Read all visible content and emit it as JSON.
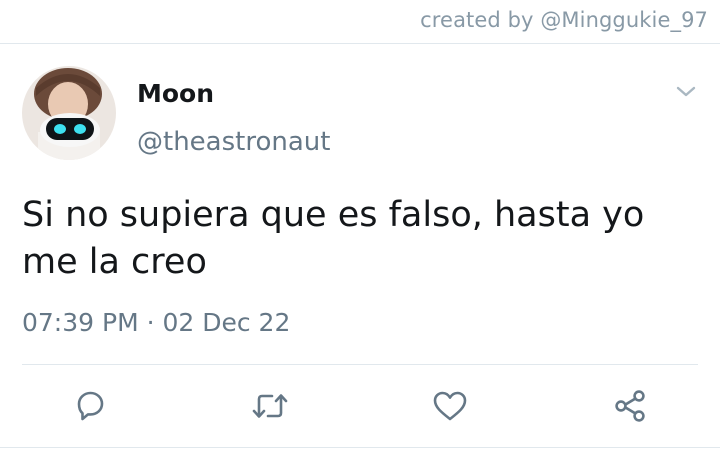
{
  "credit": {
    "text": "created by @Minggukie_97"
  },
  "tweet": {
    "author": {
      "display_name": "Moon",
      "handle": "@theastronaut",
      "avatar_icon": "avatar-photo-icon"
    },
    "menu_icon": "chevron-down-icon",
    "text_lines": [
      "Si no supiera que es falso, hasta yo",
      "me la creo"
    ],
    "timestamp": "07:39 PM · 02 Dec 22",
    "actions": [
      {
        "icon": "reply-icon"
      },
      {
        "icon": "retweet-icon"
      },
      {
        "icon": "like-icon"
      },
      {
        "icon": "share-icon"
      }
    ]
  },
  "colors": {
    "primary_text": "#14171a",
    "secondary_text": "#657786",
    "muted_text": "#8899a6",
    "icon": "#657786",
    "divider": "#e1e8ed"
  }
}
